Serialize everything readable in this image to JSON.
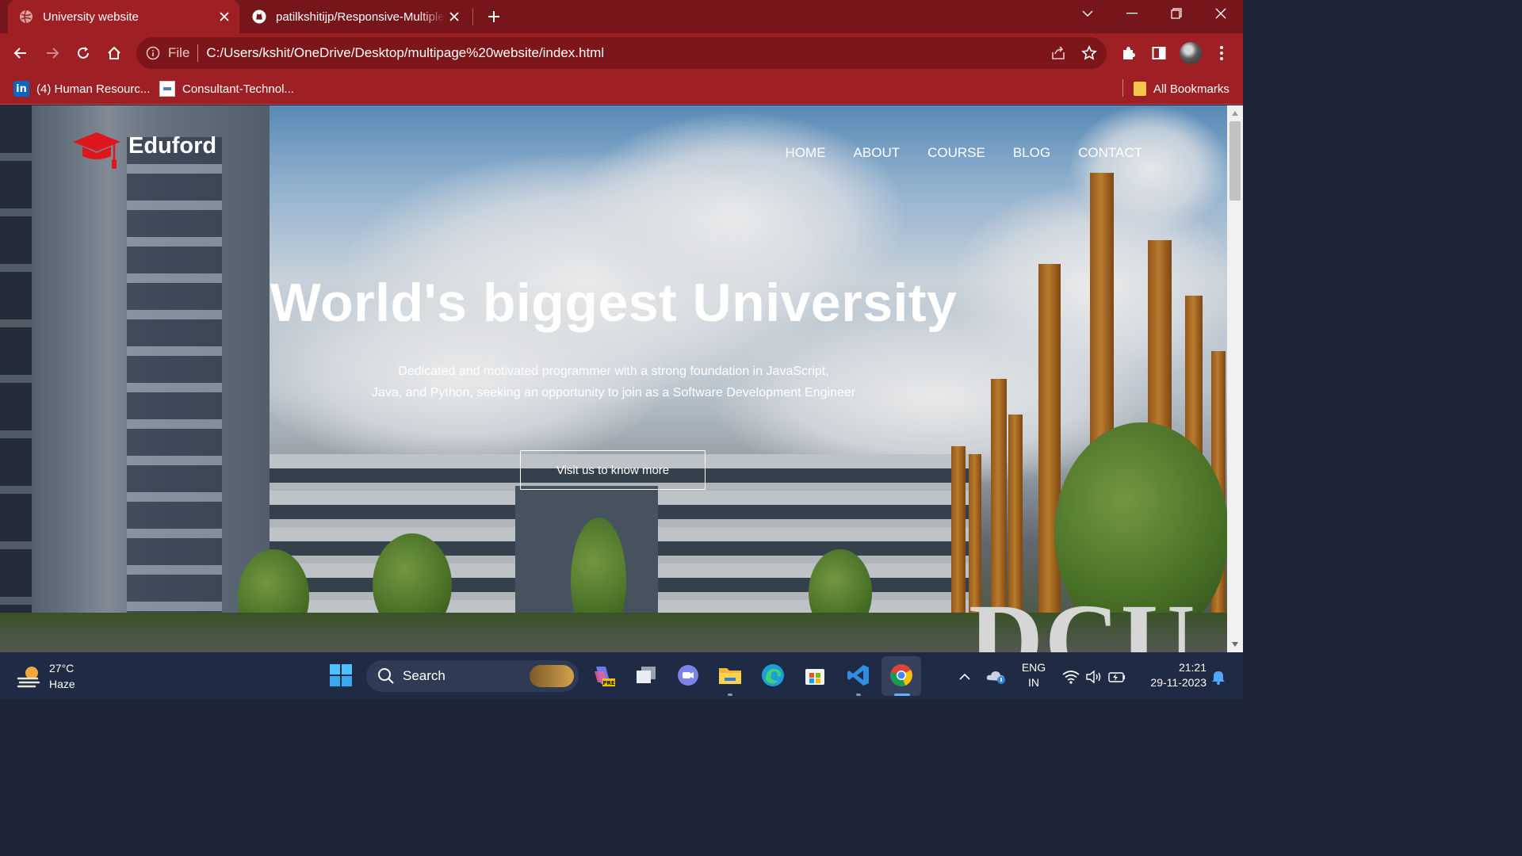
{
  "browser": {
    "tabs": [
      {
        "title": "University website",
        "active": true,
        "favicon": "globe-icon"
      },
      {
        "title": "patilkshitijp/Responsive-Multiple",
        "active": false,
        "favicon": "github-icon"
      }
    ],
    "address": {
      "scheme": "File",
      "url": "C:/Users/kshit/OneDrive/Desktop/multipage%20website/index.html"
    },
    "bookmarks": [
      {
        "label": "(4) Human Resourc...",
        "icon": "linkedin-icon"
      },
      {
        "label": "Consultant-Technol...",
        "icon": "doc-icon"
      }
    ],
    "all_bookmarks": "All Bookmarks",
    "colors": {
      "tabstrip": "#76161a",
      "toolbar": "#9e1f24",
      "omnibox": "#7d161b"
    }
  },
  "page": {
    "brand": "Eduford",
    "nav": [
      "HOME",
      "ABOUT",
      "COURSE",
      "BLOG",
      "CONTACT"
    ],
    "hero": {
      "title": "World's biggest University",
      "subtitle_line1": "Dedicated and motivated programmer with a strong foundation in JavaScript,",
      "subtitle_line2": "Java, and Python, seeking an opportunity to join as a Software Development Engineer",
      "button": "Visit us to know more"
    },
    "sign_text": "DCU",
    "colors": {
      "logo_red": "#e0151d",
      "button_border": "#ffffff"
    }
  },
  "taskbar": {
    "weather": {
      "temp": "27°C",
      "condition": "Haze"
    },
    "search_placeholder": "Search",
    "lang": {
      "line1": "ENG",
      "line2": "IN"
    },
    "clock": {
      "time": "21:21",
      "date": "29-11-2023"
    }
  }
}
